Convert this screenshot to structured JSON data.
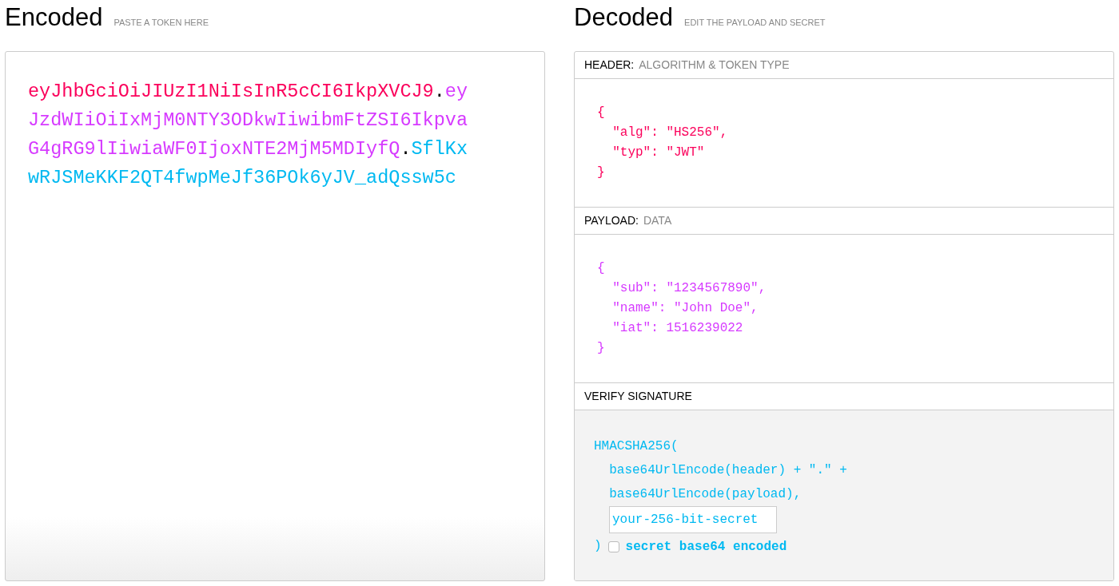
{
  "encoded": {
    "title": "Encoded",
    "subtitle": "PASTE A TOKEN HERE",
    "token": [
      {
        "kind": "header",
        "text": "eyJhbGciOiJIUzI1NiIsInR5cCI6IkpXVCJ9"
      },
      {
        "kind": "dot",
        "text": "."
      },
      {
        "kind": "payload",
        "text": "eyJzdWIiOiIxMjM0NTY3ODkwIiwibmFtZSI6IkpvaG4gRG9lIiwiaWF0IjoxNTE2MjM5MDIyfQ"
      },
      {
        "kind": "dot",
        "text": "."
      },
      {
        "kind": "signature",
        "text": "SflKxwRJSMeKKF2QT4fwpMeJf36POk6yJV_adQssw5c"
      }
    ]
  },
  "decoded": {
    "title": "Decoded",
    "subtitle": "EDIT THE PAYLOAD AND SECRET",
    "sections": [
      {
        "kind": "header",
        "label": "HEADER:",
        "hint": "ALGORITHM & TOKEN TYPE",
        "lines": [
          "{",
          "  \"alg\": \"HS256\",",
          "  \"typ\": \"JWT\"",
          "}"
        ]
      },
      {
        "kind": "payload",
        "label": "PAYLOAD:",
        "hint": "DATA",
        "lines": [
          "{",
          "  \"sub\": \"1234567890\",",
          "  \"name\": \"John Doe\",",
          "  \"iat\": 1516239022",
          "}"
        ]
      },
      {
        "kind": "signature",
        "label": "VERIFY SIGNATURE",
        "lines": [
          "HMACSHA256(",
          "  base64UrlEncode(header) + \".\" +",
          "  base64UrlEncode(payload),"
        ],
        "secret": "your-256-bit-secret",
        "close": ")",
        "base64_checkbox": {
          "label": "secret base64 encoded",
          "checked": false
        }
      }
    ]
  }
}
